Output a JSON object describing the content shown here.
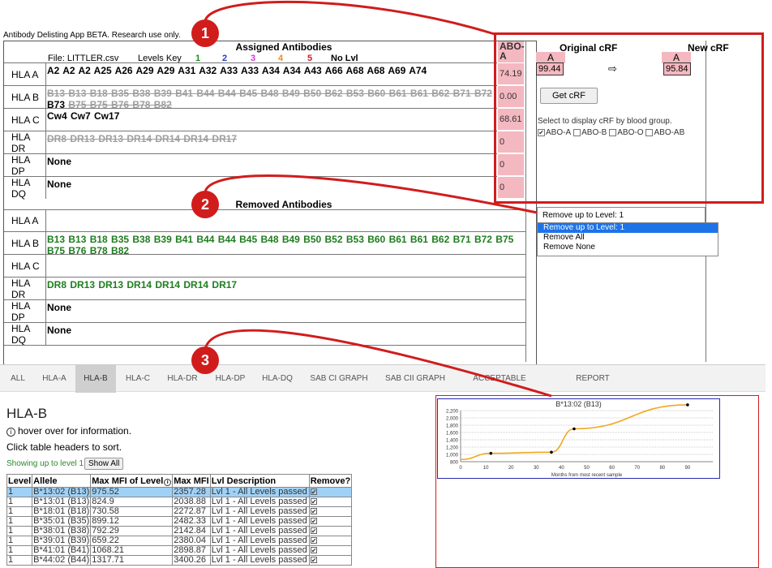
{
  "app_title": "Antibody Delisting App BETA. Research use only.",
  "assigned": {
    "heading": "Assigned Antibodies",
    "file_label": "File: LITTLER.csv",
    "levels_key_label": "Levels Key",
    "levels": [
      {
        "label": "1",
        "color": "#1f8a1f"
      },
      {
        "label": "2",
        "color": "#1e3fbf"
      },
      {
        "label": "3",
        "color": "#d13ad1"
      },
      {
        "label": "4",
        "color": "#f08a1a"
      },
      {
        "label": "5",
        "color": "#d11c1c"
      },
      {
        "label": "No Lvl",
        "color": "#000000"
      }
    ],
    "abo_header": "ABO-\nA",
    "rows": [
      {
        "label": "HLA A",
        "text": "A2 A2 A2 A25 A26 A29 A29 A31 A32 A33 A33 A34 A34 A43 A66 A68 A68 A69 A74",
        "style": "normal",
        "abo": "74.19"
      },
      {
        "label": "HLA B",
        "text": "B13 B13 B18 B35 B38 B39 B41 B44 B44 B45 B48 B49 B50 B62 B53 B60 B61 B61 B62 B71 B72",
        "tail_bold": "B73",
        "text2": "B75 B75 B76 B78 B82",
        "style": "strike",
        "abo": "0.00"
      },
      {
        "label": "HLA C",
        "text": "Cw4 Cw7 Cw17",
        "style": "normal",
        "abo": "68.61"
      },
      {
        "label": "HLA DR",
        "text": "DR8 DR13 DR13 DR14 DR14 DR14 DR17",
        "style": "strike",
        "abo": "0"
      },
      {
        "label": "HLA DP",
        "text": "None",
        "style": "normal",
        "abo": "0"
      },
      {
        "label": "HLA DQ",
        "text": "None",
        "style": "normal",
        "abo": "0"
      }
    ]
  },
  "removed": {
    "heading": "Removed Antibodies",
    "rows": [
      {
        "label": "HLA A",
        "text": ""
      },
      {
        "label": "HLA B",
        "text": "B13 B13 B18 B35 B38 B39 B41 B44 B44 B45 B48 B49 B50 B52 B53 B60 B61 B61 B62 B71 B72 B75 B75 B76 B78 B82"
      },
      {
        "label": "HLA C",
        "text": ""
      },
      {
        "label": "HLA DR",
        "text": "DR8 DR13 DR13 DR14 DR14 DR14 DR17"
      },
      {
        "label": "HLA DP",
        "text": "None"
      },
      {
        "label": "HLA DQ",
        "text": "None"
      }
    ]
  },
  "crf": {
    "original_title": "Original cRF",
    "new_title": "New cRF",
    "original_sub": "A",
    "new_sub": "A",
    "original_value": "99.44",
    "new_value": "95.84",
    "arrow": "⇨",
    "button": "Get cRF",
    "hint": "Select to display cRF by blood group.",
    "blood_groups": [
      {
        "label": "ABO-A",
        "checked": true
      },
      {
        "label": "ABO-B",
        "checked": false
      },
      {
        "label": "ABO-O",
        "checked": false
      },
      {
        "label": "ABO-AB",
        "checked": false
      }
    ]
  },
  "dropdown": {
    "selected": "Remove up to Level: 1",
    "options": [
      "Remove up to Level: 1",
      "Remove All",
      "Remove None"
    ]
  },
  "tabs": [
    "ALL",
    "HLA-A",
    "HLA-B",
    "HLA-C",
    "HLA-DR",
    "HLA-DP",
    "HLA-DQ",
    "SAB CI GRAPH",
    "SAB CII GRAPH",
    "ACCEPTABLE ANTIGENS",
    "REPORT"
  ],
  "active_tab": "HLA-B",
  "detail": {
    "title": "HLA-B",
    "hover_note": "hover over for information.",
    "sort_note": "Click table headers to sort.",
    "showing": "Showing up to level 1",
    "show_all": "Show All",
    "headers": [
      "Level",
      "Allele",
      "Max MFI of Level",
      "Max MFI",
      "Lvl Description",
      "Remove?"
    ],
    "rows": [
      [
        "1",
        "B*13:02 (B13)",
        "975.52",
        "2357.28",
        "Lvl 1 - All Levels passed"
      ],
      [
        "1",
        "B*13:01 (B13)",
        "824.9",
        "2038.88",
        "Lvl 1 - All Levels passed"
      ],
      [
        "1",
        "B*18:01 (B18)",
        "730.58",
        "2272.87",
        "Lvl 1 - All Levels passed"
      ],
      [
        "1",
        "B*35:01 (B35)",
        "899.12",
        "2482.33",
        "Lvl 1 - All Levels passed"
      ],
      [
        "1",
        "B*38:01 (B38)",
        "792.29",
        "2142.84",
        "Lvl 1 - All Levels passed"
      ],
      [
        "1",
        "B*39:01 (B39)",
        "659.22",
        "2380.04",
        "Lvl 1 - All Levels passed"
      ],
      [
        "1",
        "B*41:01 (B41)",
        "1068.21",
        "2898.87",
        "Lvl 1 - All Levels passed"
      ],
      [
        "1",
        "B*44:02 (B44)",
        "1317.71",
        "3400.26",
        "Lvl 1 - All Levels passed"
      ]
    ]
  },
  "chart_data": {
    "type": "line",
    "title": "B*13:02 (B13)",
    "xlabel": "Months from most recent sample",
    "ylabel": "",
    "xlim": [
      0,
      100
    ],
    "ylim": [
      800,
      2200
    ],
    "x_ticks": [
      0,
      10,
      20,
      30,
      40,
      50,
      60,
      70,
      80,
      90
    ],
    "y_ticks": [
      "800",
      "1,000",
      "1,200",
      "1,400",
      "1,600",
      "1,800",
      "2,000",
      "2,200"
    ],
    "x": [
      0,
      12,
      36,
      45,
      90
    ],
    "y": [
      860,
      1030,
      1060,
      1700,
      2357
    ],
    "line_color": "#f0a81e",
    "grid": true
  },
  "callouts": [
    "1",
    "2",
    "3"
  ]
}
